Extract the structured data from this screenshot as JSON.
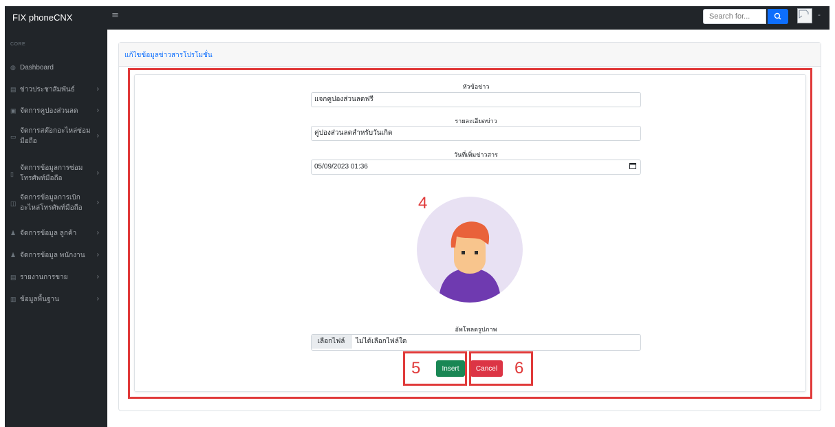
{
  "topbar": {
    "brand": "FIX phoneCNX",
    "menu_icon": "≡",
    "search_placeholder": "Search for...",
    "search_icon": "search-icon",
    "avatar_caret": "-"
  },
  "sidebar": {
    "section_core": "CORE",
    "items": [
      {
        "label": "Dashboard",
        "icon": "dashboard-icon"
      },
      {
        "label": "ข่าวประชาสัมพันธ์",
        "icon": "news-icon"
      },
      {
        "label": "จัดการคูปองส่วนลด",
        "icon": "coupon-icon"
      },
      {
        "label": "จัดการสต๊อกอะไหล่ซ่อมมือถือ",
        "icon": "box-icon"
      },
      {
        "label": "จัดการข้อมูลการซ่อมโทรศัพท์มือถือ",
        "icon": "phone-icon"
      },
      {
        "label": "จัดการข้อมูลการเบิกอะไหล่โทรศัพท์มือถือ",
        "icon": "table-icon"
      },
      {
        "label": "จัดการข้อมูล ลูกค้า",
        "icon": "user-icon"
      },
      {
        "label": "จัดการข้อมูล พนักงาน",
        "icon": "user-icon"
      },
      {
        "label": "รายงานการขาย",
        "icon": "report-icon"
      },
      {
        "label": "ข้อมูลพื้นฐาน",
        "icon": "database-icon"
      }
    ]
  },
  "card": {
    "title": "แก้ไขข้อมูลข่าวสารโปรโมชั่น"
  },
  "form": {
    "headline_label": "หัวข้อข่าว",
    "headline_value": "แจกคูปองส่วนลดฟรี",
    "detail_label": "รายละเอียดข่าว",
    "detail_value": "คู่ปองส่วนลดสำหรับวันเกิด",
    "date_label": "วันที่เพิ่มข่าวสาร",
    "date_value": "05/09/2023 01:36",
    "upload_label": "อัพโหลดรูปภาพ",
    "file_button": "เลือกไฟล์",
    "file_status": "ไม่ได้เลือกไฟล์ใด",
    "insert_label": "Insert",
    "cancel_label": "Cancel"
  },
  "annotations": {
    "image_number": "4",
    "insert_number": "5",
    "cancel_number": "6",
    "color": "#e03a3a"
  },
  "colors": {
    "dark": "#212529",
    "primary": "#0d6efd",
    "success": "#198754",
    "danger": "#dc3545"
  }
}
